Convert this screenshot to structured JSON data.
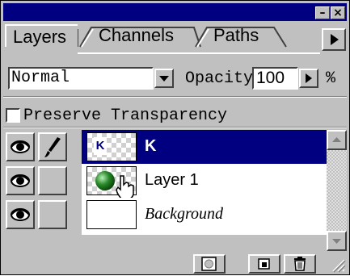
{
  "window": {
    "minimize_glyph": "–",
    "close_glyph": "×"
  },
  "tabs": [
    {
      "label": "Layers",
      "active": true
    },
    {
      "label": "Channels",
      "active": false
    },
    {
      "label": "Paths",
      "active": false
    }
  ],
  "controls": {
    "blend_mode": "Normal",
    "opacity_label": "Opacity:",
    "opacity_value": "100",
    "percent_symbol": "%",
    "preserve_transparency_label": "Preserve Transparency",
    "preserve_transparency_checked": false
  },
  "layers": [
    {
      "name": "K",
      "selected": true,
      "visible": true,
      "thumbnail_text": "K"
    },
    {
      "name": "Layer 1",
      "selected": false,
      "visible": true
    },
    {
      "name": "Background",
      "selected": false,
      "visible": true,
      "italic": true
    }
  ],
  "colors": {
    "titlebar": "#000080",
    "selection": "#000080",
    "panel": "#c0c0c0"
  },
  "icons": [
    "eye-icon",
    "paintbrush-icon",
    "panel-menu-arrow-icon",
    "dropdown-arrow-icon",
    "layer-mask-icon",
    "new-layer-icon",
    "trash-icon",
    "hand-cursor-icon"
  ]
}
